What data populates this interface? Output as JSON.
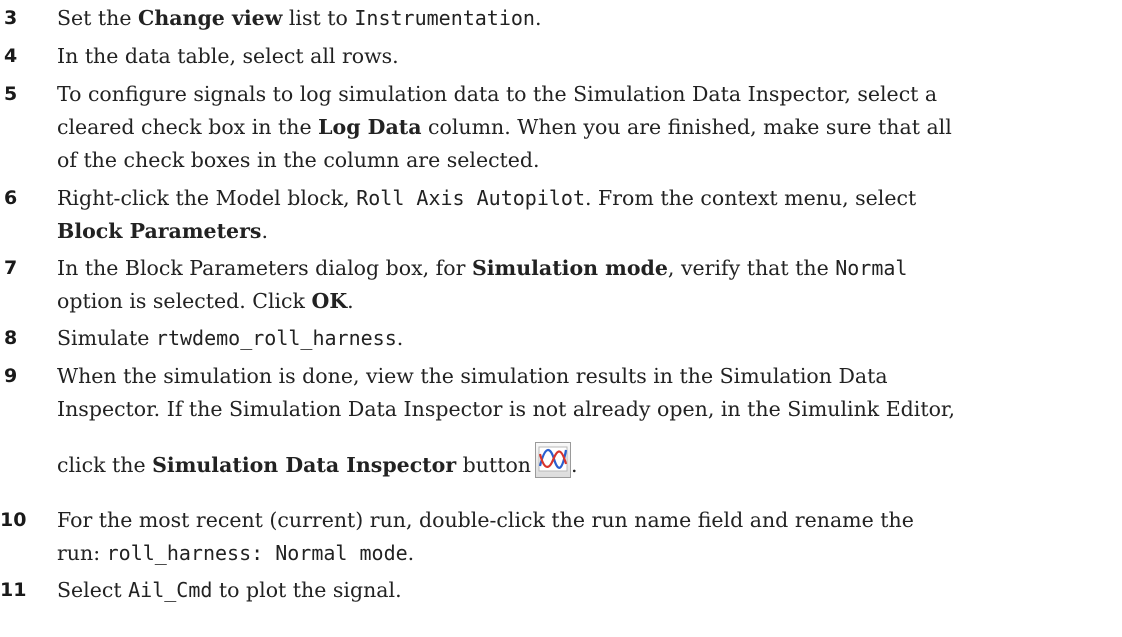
{
  "steps": [
    {
      "num": "3",
      "a": "Set the ",
      "b1": "Change view",
      "c": " list to ",
      "code1": "Instrumentation",
      "d": "."
    },
    {
      "num": "4",
      "text": "In the data table, select all rows."
    },
    {
      "num": "5",
      "line1": "To configure signals to log simulation data to the Simulation Data Inspector, select a",
      "line2a": "cleared check box in the ",
      "line2b": "Log Data",
      "line2c": " column. When you are finished, make sure that all",
      "line3": "of the check boxes in the column are selected."
    },
    {
      "num": "6",
      "a": "Right-click the Model block, ",
      "code1": "Roll Axis Autopilot",
      "b": ". From the context menu, select",
      "bold2": "Block Parameters",
      "end": "."
    },
    {
      "num": "7",
      "a": "In the Block Parameters dialog box, for ",
      "bold1": "Simulation mode",
      "b": ", verify that the ",
      "code1": "Normal",
      "line2a": "option is selected. Click ",
      "bold2": "OK",
      "end": "."
    },
    {
      "num": "8",
      "a": "Simulate ",
      "code1": "rtwdemo_roll_harness",
      "end": "."
    },
    {
      "num": "9",
      "line1": "When the simulation is done, view the simulation results in the Simulation Data",
      "line2": "Inspector. If the Simulation Data Inspector is not already open, in the Simulink Editor,",
      "line3a": "click the ",
      "bold1": "Simulation Data Inspector",
      "line3b": " button",
      "end": "."
    },
    {
      "num": "10",
      "line1": "For the most recent (current) run, double-click the run name field and rename the",
      "line2a": "run: ",
      "code1": "roll_harness: Normal mode",
      "end": "."
    },
    {
      "num": "11",
      "a": "Select ",
      "code1": "Ail_Cmd",
      "b": " to plot the signal."
    }
  ],
  "icons": {
    "sdi_button": "simulation-data-inspector-icon"
  }
}
